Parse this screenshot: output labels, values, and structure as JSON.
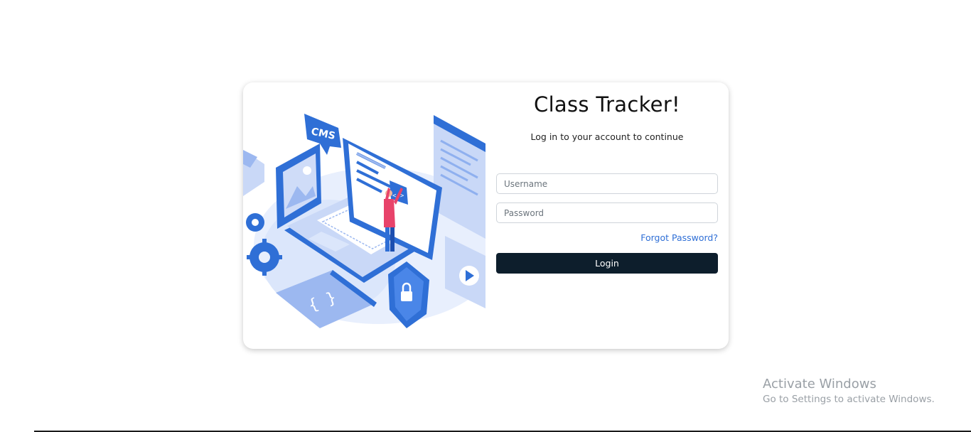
{
  "login": {
    "title": "Class Tracker!",
    "subtitle": "Log in to your account to continue",
    "username_placeholder": "Username",
    "password_placeholder": "Password",
    "forgot_label": "Forgot Password?",
    "login_label": "Login"
  },
  "illustration": {
    "cms_label": "CMS",
    "code_label": "</>"
  },
  "watermark": {
    "title": "Activate Windows",
    "subtitle": "Go to Settings to activate Windows."
  },
  "colors": {
    "primary_blue": "#2f6fd6",
    "light_blue": "#dbe6fb",
    "button_dark": "#0d1e2c",
    "accent_pink": "#e8436a"
  }
}
